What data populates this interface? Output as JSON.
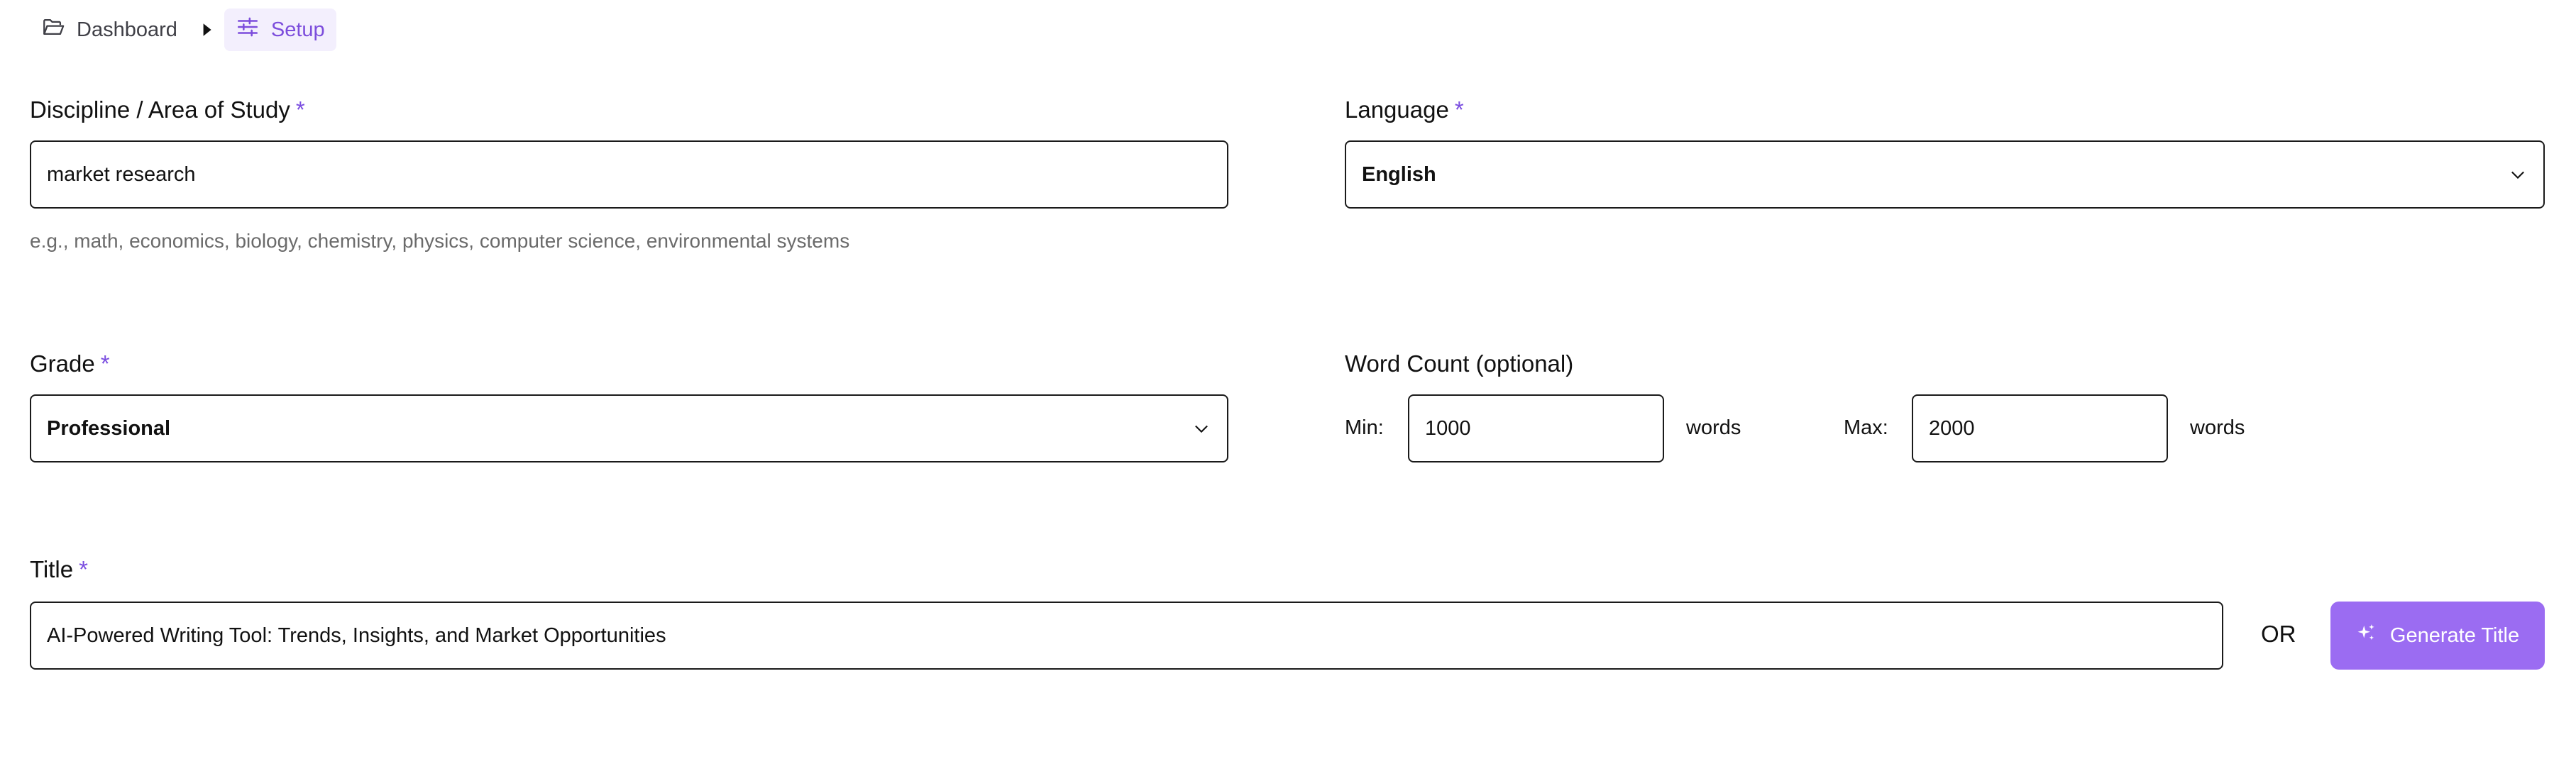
{
  "breadcrumb": {
    "items": [
      {
        "label": "Dashboard",
        "icon": "folder-open-icon"
      },
      {
        "label": "Setup",
        "icon": "sliders-icon",
        "active": true
      }
    ],
    "separator_icon": "caret-right-icon"
  },
  "form": {
    "discipline": {
      "label": "Discipline / Area of Study",
      "required_mark": "*",
      "value": "market research",
      "hint": "e.g., math, economics, biology, chemistry, physics, computer science, environmental systems"
    },
    "language": {
      "label": "Language",
      "required_mark": "*",
      "value": "English"
    },
    "grade": {
      "label": "Grade",
      "required_mark": "*",
      "value": "Professional"
    },
    "word_count": {
      "label": "Word Count (optional)",
      "min_label": "Min:",
      "min_value": "1000",
      "max_label": "Max:",
      "max_value": "2000",
      "unit": "words"
    },
    "title": {
      "label": "Title",
      "required_mark": "*",
      "value": "AI-Powered Writing Tool: Trends, Insights, and Market Opportunities",
      "or_text": "OR",
      "generate_button": "Generate Title"
    }
  },
  "colors": {
    "accent": "#7b4ee0",
    "button_bg": "#9b6cf2",
    "active_crumb_bg": "#f3effd"
  }
}
